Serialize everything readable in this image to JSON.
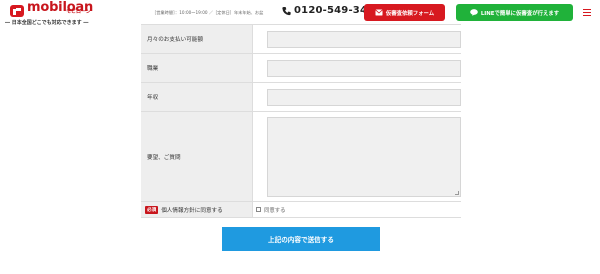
{
  "header": {
    "logo_text": "mobiloan",
    "logo_sub": "モビローン",
    "tagline": "― 日本全国どこでも対応できます ―",
    "hours": "［営業時間］：10:00～19:00 ／［定休日］年末年始、お盆",
    "phone": "0120-549-341",
    "form_button": "仮審査依頼フォーム",
    "line_button": "LINEで簡単に仮審査が行えます"
  },
  "form": {
    "rows": [
      {
        "label": "月々のお支払い可能額"
      },
      {
        "label": "職業"
      },
      {
        "label": "年収"
      },
      {
        "label": "要望、ご質問"
      }
    ],
    "privacy": {
      "required_badge": "必須",
      "label": "個人情報方針に同意する",
      "checkbox_label": "同意する"
    },
    "submit_label": "上記の内容で送信する"
  },
  "colors": {
    "brand_red": "#d71920",
    "line_green": "#20b23a",
    "submit_blue": "#1f9ae0"
  }
}
